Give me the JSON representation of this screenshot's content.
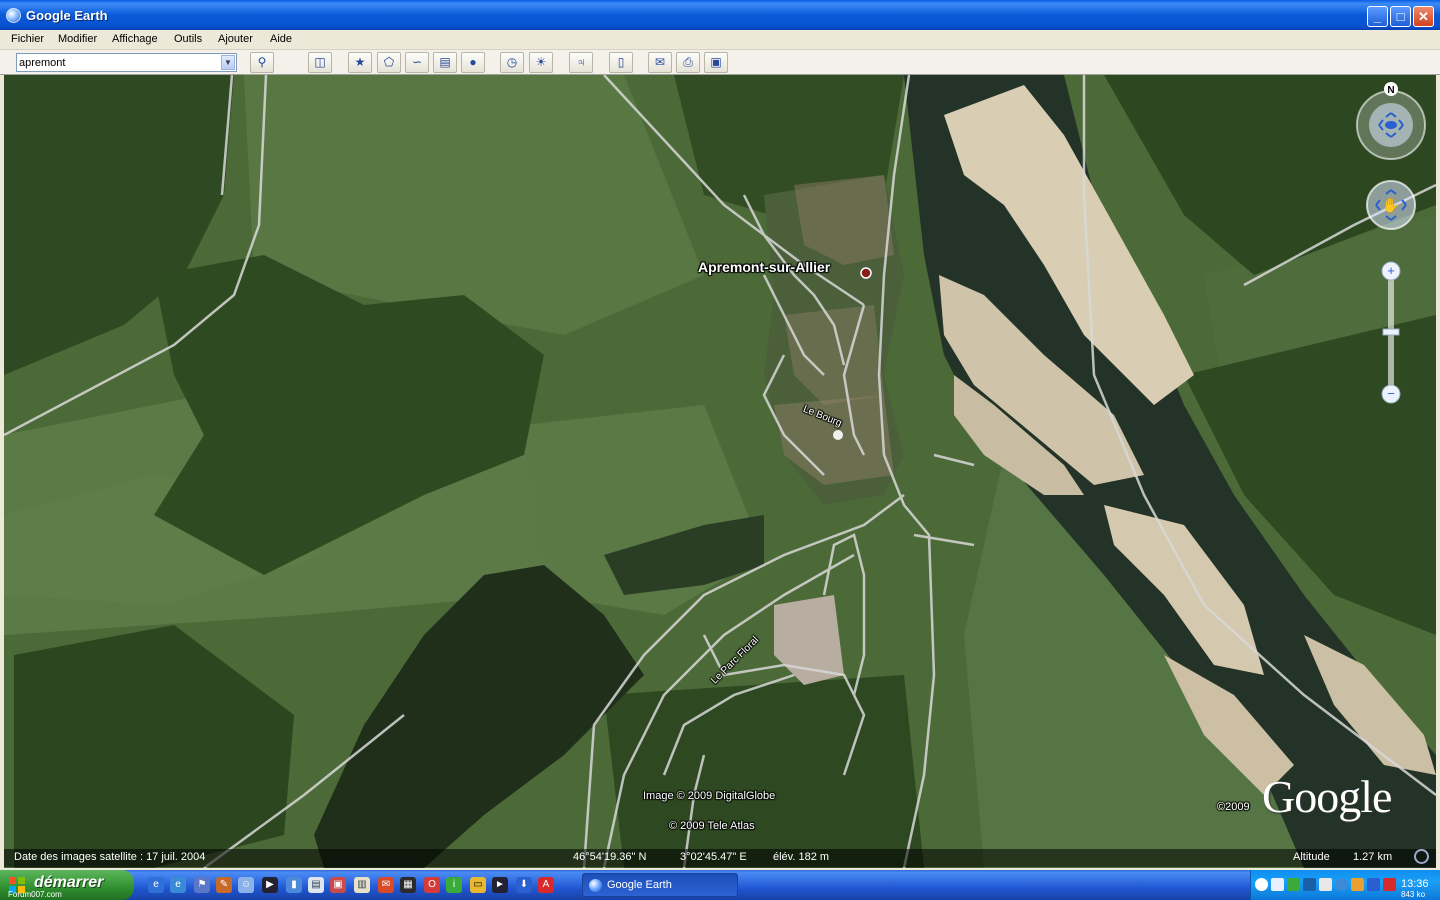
{
  "window": {
    "title": "Google Earth",
    "app_icon": "google-earth-icon"
  },
  "titlebar_buttons": {
    "minimize": "_",
    "maximize": "□",
    "close": "✕"
  },
  "menu": [
    "Fichier",
    "Modifier",
    "Affichage",
    "Outils",
    "Ajouter",
    "Aide"
  ],
  "search": {
    "value": "apremont"
  },
  "toolbar_icons": [
    "search-icon",
    "sidebar-icon",
    "placemark-icon",
    "polygon-icon",
    "path-icon",
    "image-overlay-icon",
    "record-tour-icon",
    "historical-imagery-icon",
    "sunlight-icon",
    "planets-icon",
    "ruler-icon",
    "email-icon",
    "print-icon",
    "save-image-icon"
  ],
  "map": {
    "place_label": "Apremont-sur-Allier",
    "road_labels": [
      "Le Bourg",
      "Le Parc Floral"
    ],
    "attribution": [
      "Image © 2009 DigitalGlobe",
      "© 2009 Tele Atlas"
    ],
    "logo": "Google",
    "logo_year": "©2009",
    "compass_north": "N",
    "zoom_plus": "+",
    "zoom_minus": "−"
  },
  "status": {
    "imagery_date": "Date des images satellite : 17 juil. 2004",
    "latitude": "46°54'19.36\" N",
    "longitude": "3°02'45.47\" E",
    "elevation": "élév.   182 m",
    "altitude_label": "Altitude",
    "altitude_value": "1.27 km"
  },
  "taskbar": {
    "start_label": "démarrer",
    "start_sub": "Forum007.com",
    "task_item": "Google Earth",
    "clock": "13:36",
    "clock_sub": "843 ko"
  }
}
